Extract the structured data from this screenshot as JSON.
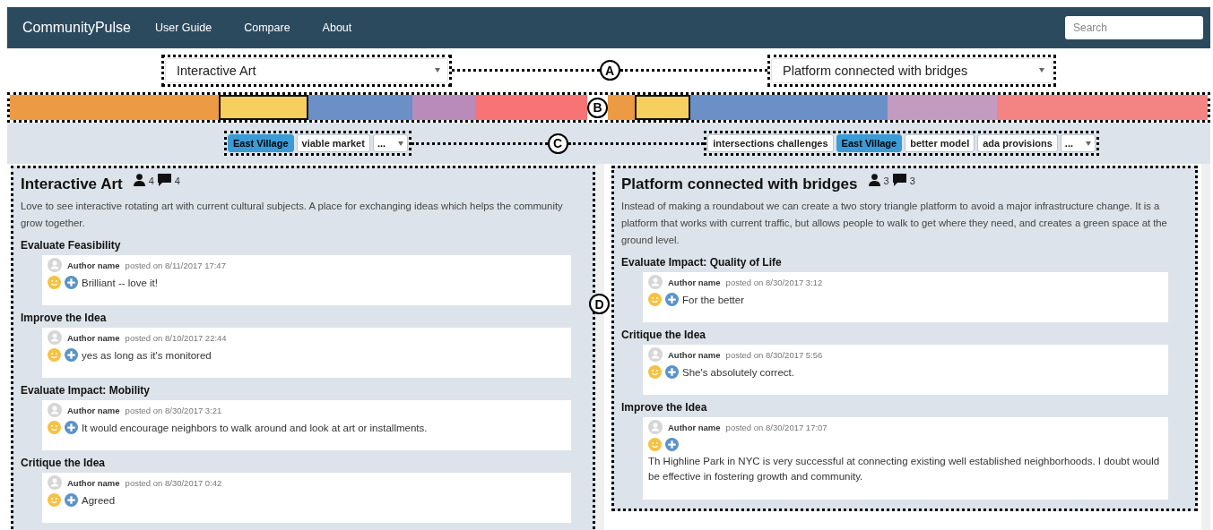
{
  "navbar": {
    "brand": "CommunityPulse",
    "links": [
      "User Guide",
      "Compare",
      "About"
    ],
    "search": {
      "placeholder": "Search"
    }
  },
  "callouts": [
    "A",
    "B",
    "C",
    "D"
  ],
  "columns": [
    {
      "select": "Interactive Art",
      "segments": [
        {
          "color": "#ec9a43",
          "selected": false
        },
        {
          "color": "#f7cf5f",
          "selected": true
        },
        {
          "color": "#6b8fc7",
          "selected": false
        },
        {
          "color": "#b98bbb",
          "selected": false
        },
        {
          "color": "#f77375",
          "selected": false
        }
      ],
      "tags": [
        {
          "label": "East Village",
          "selected": true
        },
        {
          "label": "viable market",
          "selected": false
        }
      ],
      "more": "...",
      "idea": {
        "title": "Interactive Art",
        "people": "4",
        "comments": "4",
        "description": "Love to see interactive rotating art with current cultural subjects. A place for exchanging ideas which helps the community grow together.",
        "sections": [
          {
            "heading": "Evaluate Feasibility",
            "posts": [
              {
                "kind": "inline",
                "author": "Author name",
                "date": "posted on 8/11/2017 17:47",
                "text": "Brilliant -- love it!"
              }
            ]
          },
          {
            "heading": "Improve the Idea",
            "posts": [
              {
                "kind": "inline",
                "author": "Author name",
                "date": "posted on 8/10/2017 22:44",
                "text": "yes as long as it's monitored"
              }
            ]
          },
          {
            "heading": "Evaluate Impact: Mobility",
            "posts": [
              {
                "kind": "inline",
                "author": "Author name",
                "date": "posted on 8/30/2017 3:21",
                "text": "It would encourage neighbors to walk around and look at art or installments."
              }
            ]
          },
          {
            "heading": "Critique the Idea",
            "posts": [
              {
                "kind": "inline",
                "author": "Author name",
                "date": "posted on 8/30/2017 0:42",
                "text": "Agreed"
              }
            ]
          }
        ]
      }
    },
    {
      "select": "Platform connected with bridges",
      "segments": [
        {
          "color": "#ec9a43",
          "selected": false
        },
        {
          "color": "#f7cf5f",
          "selected": true
        },
        {
          "color": "#6b8fc7",
          "selected": false
        },
        {
          "color": "#c39ac0",
          "selected": false
        },
        {
          "color": "#f48383",
          "selected": false
        }
      ],
      "tags": [
        {
          "label": "intersections challenges",
          "selected": false
        },
        {
          "label": "East Village",
          "selected": true
        },
        {
          "label": "better model",
          "selected": false
        },
        {
          "label": "ada provisions",
          "selected": false
        }
      ],
      "more": "...",
      "idea": {
        "title": "Platform connected with bridges",
        "people": "3",
        "comments": "3",
        "description": "Instead of making a roundabout we can create a two story triangle platform to avoid a major infrastructure change. It is a platform that works with current traffic, but allows people to walk to get where they need, and creates a green space at the ground level.",
        "sections": [
          {
            "heading": "Evaluate Impact: Quality of Life",
            "posts": [
              {
                "kind": "inline",
                "author": "Author name",
                "date": "posted on 8/30/2017 3:12",
                "text": "For the better"
              }
            ]
          },
          {
            "heading": "Critique the Idea",
            "posts": [
              {
                "kind": "inline",
                "author": "Author name",
                "date": "posted on 8/30/2017 5:56",
                "text": "She's absolutely correct."
              }
            ]
          },
          {
            "heading": "Improve the Idea",
            "posts": [
              {
                "kind": "block",
                "author": "Author name",
                "date": "posted on 8/30/2017 17:07",
                "text": "Th Highline Park in NYC is very successful at connecting existing well established neighborhoods. I doubt would be effective in fostering growth and community."
              }
            ]
          }
        ]
      }
    }
  ]
}
